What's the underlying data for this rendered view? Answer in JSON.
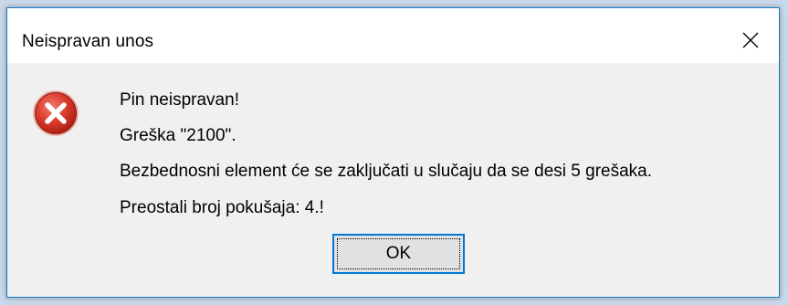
{
  "dialog": {
    "title": "Neispravan unos",
    "icon": "error-icon",
    "messages": [
      "Pin neispravan!",
      "Greška \"2100\".",
      "Bezbednosni element će se zaključati u slučaju da se desi 5 grešaka.",
      "Preostali broj pokušaja: 4.!"
    ],
    "ok_label": "OK",
    "close_icon": "close-icon"
  },
  "colors": {
    "accent": "#0078d7",
    "window_border": "#1979ca",
    "error_red": "#c42b1c",
    "background": "#f0f0f0"
  }
}
